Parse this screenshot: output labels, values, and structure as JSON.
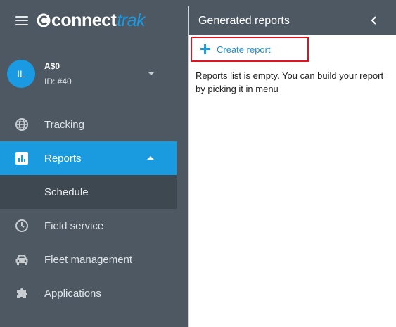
{
  "brand": {
    "name_part1": "connect",
    "name_part2": "trak"
  },
  "user": {
    "initials": "IL",
    "name": "A$0",
    "id": "ID: #40"
  },
  "nav": {
    "tracking": "Tracking",
    "reports": "Reports",
    "schedule": "Schedule",
    "field_service": "Field service",
    "fleet_management": "Fleet management",
    "applications": "Applications"
  },
  "panel": {
    "title": "Generated reports",
    "create_label": "Create report",
    "empty_text": "Reports list is empty. You can build your report by picking it in menu"
  },
  "colors": {
    "accent": "#1a9bdf",
    "sidebar": "#4d5863",
    "highlight": "#e0141e"
  }
}
